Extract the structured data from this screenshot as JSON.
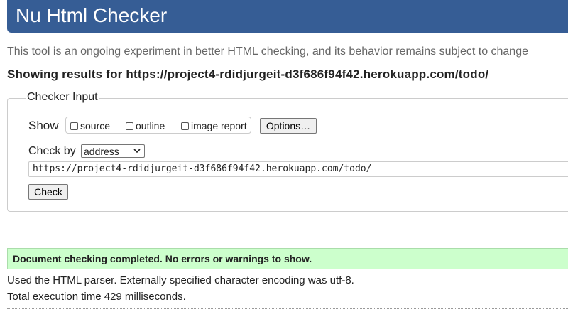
{
  "header": {
    "title": "Nu Html Checker"
  },
  "intro_text": "This tool is an ongoing experiment in better HTML checking, and its behavior remains subject to change",
  "results_heading": "Showing results for https://project4-rdidjurgeit-d3f686f94f42.herokuapp.com/todo/",
  "checker_input": {
    "legend": "Checker Input",
    "show_label": "Show",
    "options": [
      {
        "label": "source",
        "checked": false
      },
      {
        "label": "outline",
        "checked": false
      },
      {
        "label": "image report",
        "checked": false
      }
    ],
    "options_button": "Options…",
    "check_by_label": "Check by",
    "check_by_selected": "address",
    "url_value": "https://project4-rdidjurgeit-d3f686f94f42.herokuapp.com/todo/",
    "check_button": "Check"
  },
  "status": {
    "success_message": "Document checking completed. No errors or warnings to show.",
    "parser_info": "Used the HTML parser. Externally specified character encoding was utf-8.",
    "execution_time": "Total execution time 429 milliseconds."
  },
  "colors": {
    "header_bg": "#365d95",
    "success_bg": "#ccffcc",
    "intro_text": "#666666"
  },
  "icons": {
    "select_arrow": "chevron-down-icon"
  }
}
